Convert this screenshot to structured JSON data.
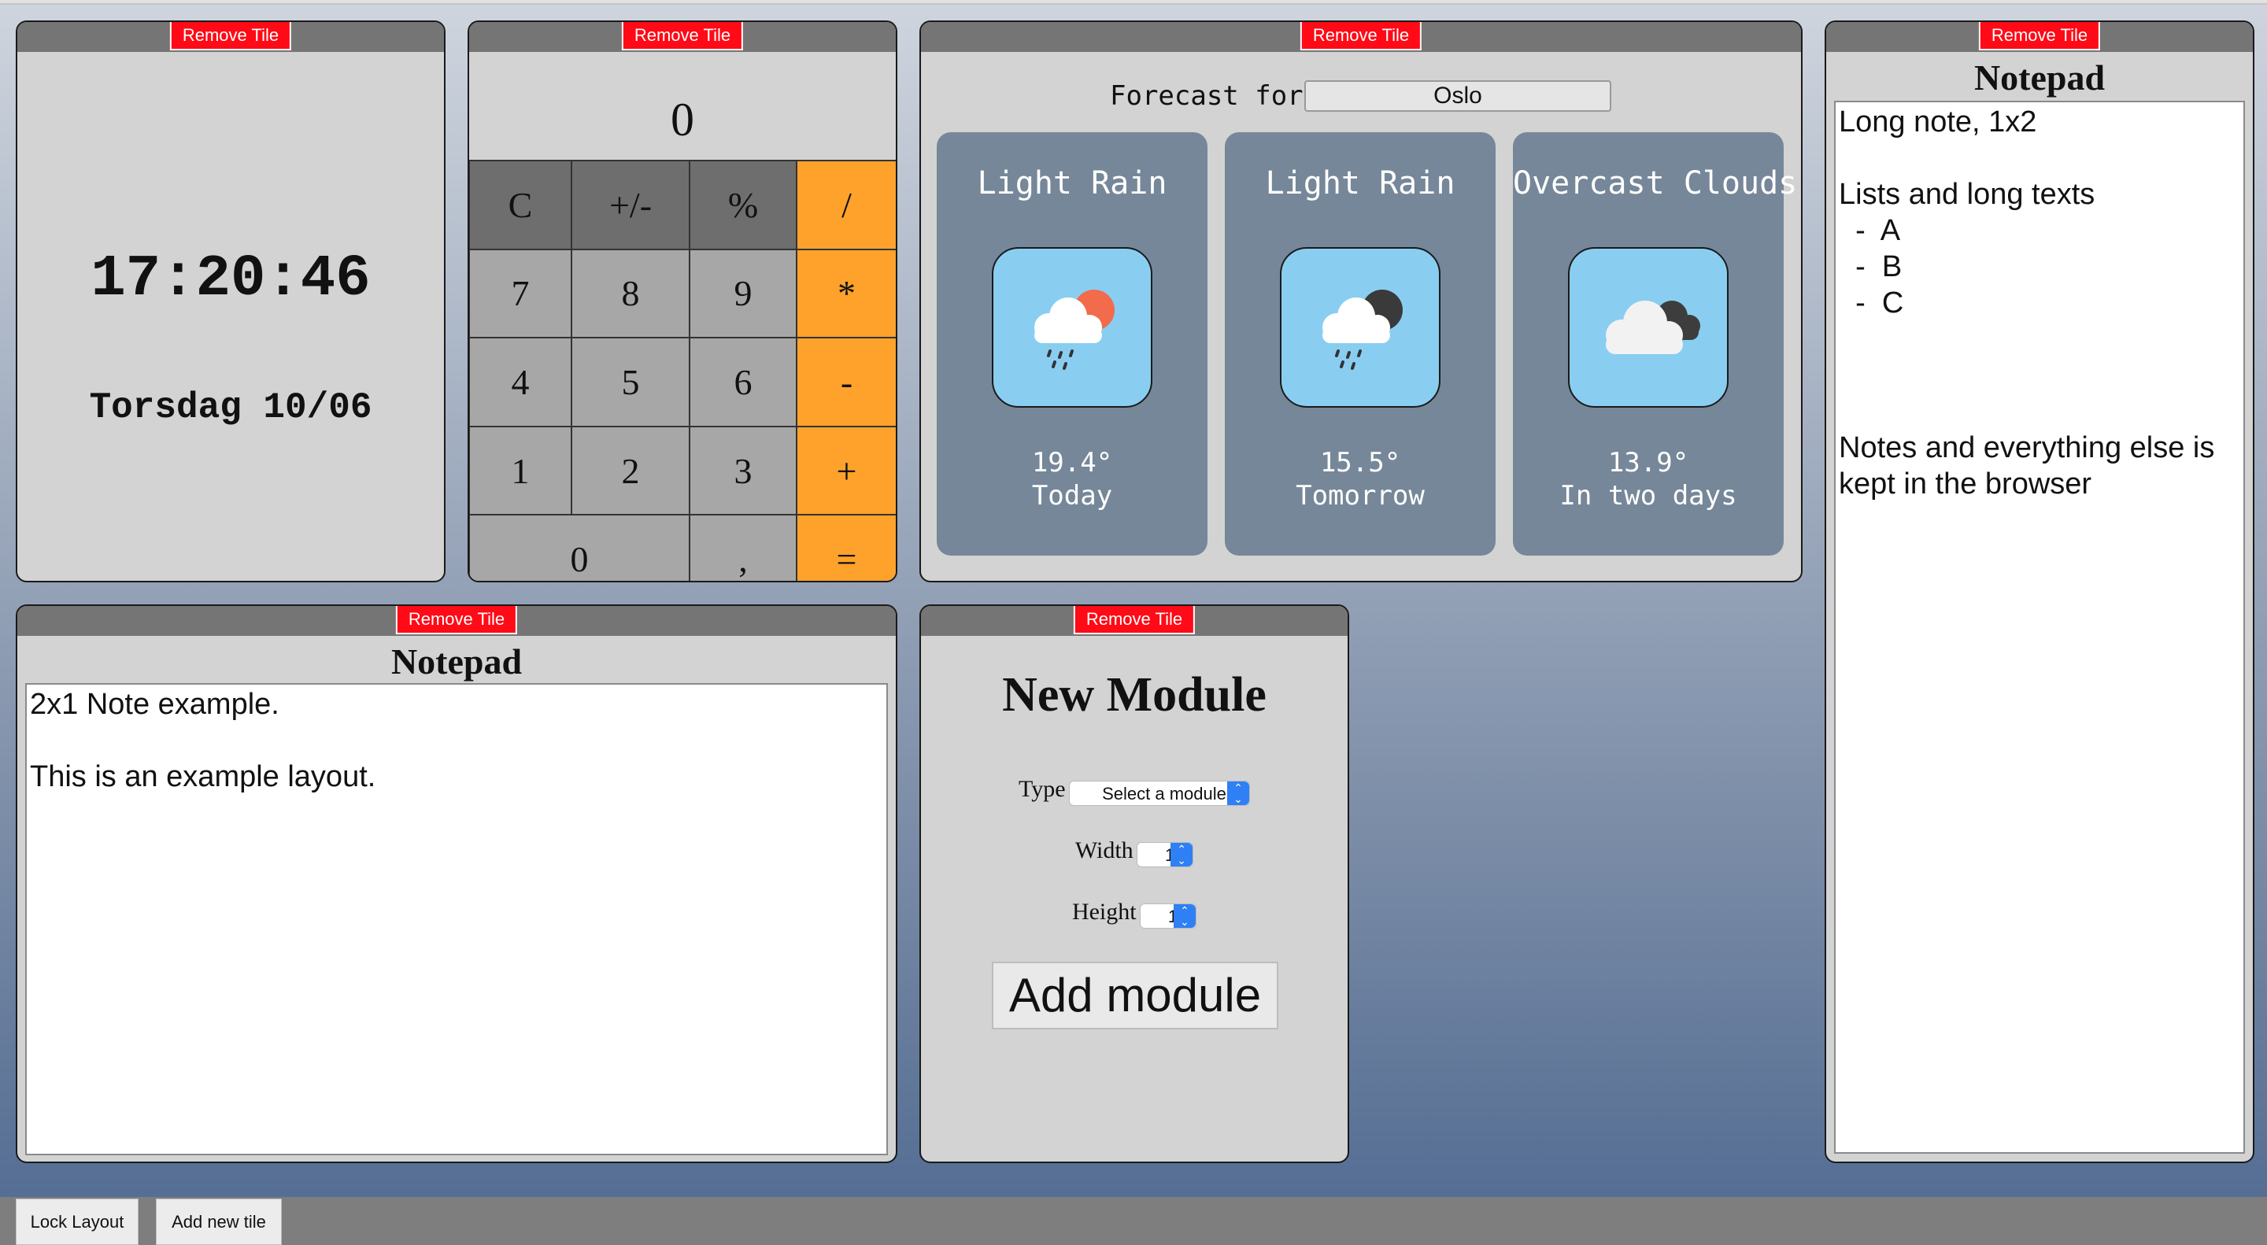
{
  "tiles": {
    "remove_label": "Remove Tile"
  },
  "clock": {
    "time": "17:20:46",
    "date": "Torsdag 10/06"
  },
  "calculator": {
    "display": "0",
    "keys": {
      "clear": "C",
      "sign": "+/-",
      "percent": "%",
      "divide": "/",
      "seven": "7",
      "eight": "8",
      "nine": "9",
      "multiply": "*",
      "four": "4",
      "five": "5",
      "six": "6",
      "minus": "-",
      "one": "1",
      "two": "2",
      "three": "3",
      "plus": "+",
      "zero": "0",
      "comma": ",",
      "equals": "="
    }
  },
  "weather": {
    "label": "Forecast for",
    "city": "Oslo",
    "days": [
      {
        "desc": "Light Rain",
        "temp": "19.4°",
        "day": "Today",
        "icon": "light-rain-day-icon"
      },
      {
        "desc": "Light Rain",
        "temp": "15.5°",
        "day": "Tomorrow",
        "icon": "light-rain-night-icon"
      },
      {
        "desc": "Overcast Clouds",
        "temp": "13.9°",
        "day": "In two days",
        "icon": "overcast-clouds-icon"
      }
    ]
  },
  "notepad_long": {
    "title": "Notepad",
    "text": "Long note, 1x2\n\nLists and long texts\n  -  A\n  -  B\n  -  C\n\n\n\nNotes and everything else is\nkept in the browser"
  },
  "notepad_wide": {
    "title": "Notepad",
    "text": "2x1 Note example.\n\nThis is an example layout."
  },
  "new_module": {
    "title": "New Module",
    "type_label": "Type",
    "type_value": "Select a module",
    "width_label": "Width",
    "width_value": "1",
    "height_label": "Height",
    "height_value": "1",
    "add_label": "Add module"
  },
  "footer": {
    "lock_label": "Lock Layout",
    "add_tile_label": "Add new tile"
  },
  "colors": {
    "remove_button": "#ff0a16",
    "calc_operator": "#ffa22b",
    "weather_card": "#768799",
    "weather_icon_bg": "#89cef0"
  }
}
